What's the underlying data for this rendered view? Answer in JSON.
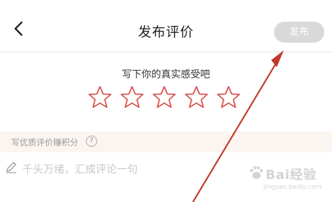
{
  "header": {
    "title": "发布评价",
    "publish_label": "发布"
  },
  "rating": {
    "prompt": "写下你的真实感受吧",
    "star_count": 5,
    "selected": 0,
    "star_color": "#d9534f"
  },
  "points_tip": {
    "text": "写优质评价赚积分",
    "help_symbol": "?"
  },
  "comment": {
    "placeholder": "千头万绪，汇成评论一句"
  },
  "watermark": {
    "text": "Bai经验",
    "url": "jingyan.baidu.com"
  },
  "colors": {
    "publish_bg": "#d9d9d9",
    "points_bg": "#fbf5f1",
    "arrow": "#c0392b"
  }
}
